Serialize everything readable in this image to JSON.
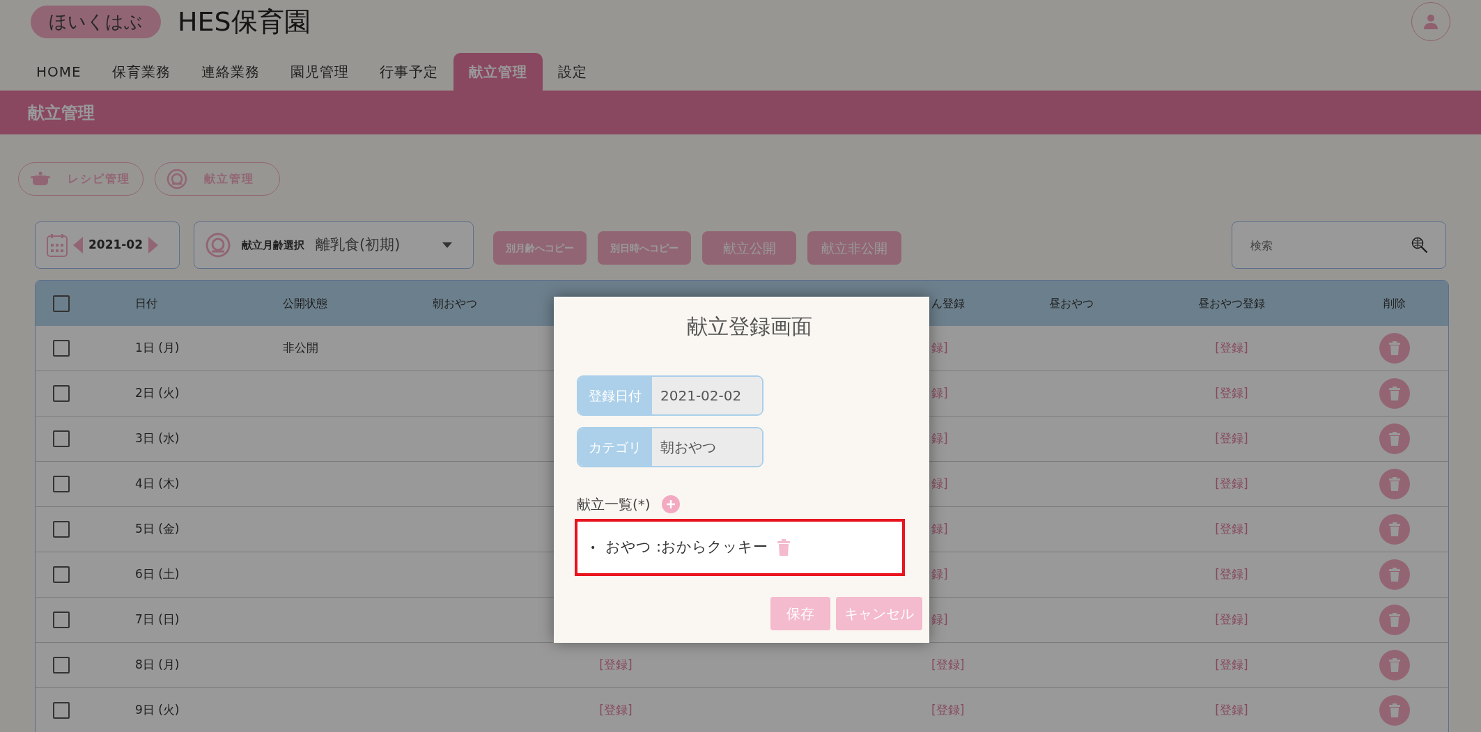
{
  "header": {
    "logo": "ほいくはぶ",
    "title": "HES保育園"
  },
  "tabs": [
    {
      "label": "HOME",
      "selected": false
    },
    {
      "label": "保育業務",
      "selected": false
    },
    {
      "label": "連絡業務",
      "selected": false
    },
    {
      "label": "園児管理",
      "selected": false
    },
    {
      "label": "行事予定",
      "selected": false
    },
    {
      "label": "献立管理",
      "selected": true
    },
    {
      "label": "設定",
      "selected": false
    }
  ],
  "page_title": "献立管理",
  "sub_nav": [
    {
      "label": "レシピ管理",
      "kind": "recipe"
    },
    {
      "label": "献立管理",
      "kind": "menu"
    }
  ],
  "toolbar": {
    "month": "2021-02",
    "age_label": "献立月齢選択",
    "age_value": "離乳食(初期)",
    "buttons": [
      "別月齢へコピー",
      "別日時へコピー",
      "献立公開",
      "献立非公開"
    ],
    "search": {
      "placeholder": "検索"
    }
  },
  "table": {
    "header_checked": false,
    "columns": {
      "date": "日付",
      "publish_status": "公開状態",
      "morning_snack": "朝おやつ",
      "column_5": "ん登録",
      "afternoon_snack": "昼おやつ",
      "afternoon_snack_register": "昼おやつ登録",
      "delete": "削除"
    },
    "rows": [
      {
        "checked": false,
        "date": "1日 (月)",
        "publish_status": "非公開",
        "column_5": "録]",
        "afternoon_snack_register": "[登録]"
      },
      {
        "checked": false,
        "date": "2日 (火)",
        "column_5": "録]",
        "afternoon_snack_register": "[登録]"
      },
      {
        "checked": false,
        "date": "3日 (水)",
        "column_5": "録]",
        "afternoon_snack_register": "[登録]"
      },
      {
        "checked": false,
        "date": "4日 (木)",
        "column_5": "録]",
        "afternoon_snack_register": "[登録]"
      },
      {
        "checked": false,
        "date": "5日 (金)",
        "column_5": "録]",
        "afternoon_snack_register": "[登録]"
      },
      {
        "checked": false,
        "date": "6日 (土)",
        "column_5": "録]",
        "afternoon_snack_register": "[登録]"
      },
      {
        "checked": false,
        "date": "7日 (日)",
        "column_5": "録]",
        "afternoon_snack_register": "[登録]"
      },
      {
        "checked": false,
        "date": "8日 (月)",
        "column_4": "[登録]",
        "column_5": "[登録]",
        "afternoon_snack_register": "[登録]"
      },
      {
        "checked": false,
        "date": "9日 (火)",
        "column_4": "[登録]",
        "column_5": "[登録]",
        "afternoon_snack_register": "[登録]"
      }
    ]
  },
  "modal": {
    "title": "献立登録画面",
    "fields": [
      {
        "label": "登録日付",
        "value": "2021-02-02"
      },
      {
        "label": "カテゴリ",
        "value": "朝おやつ"
      }
    ],
    "list_label": "献立一覧(*)",
    "items": [
      {
        "bullet": "•",
        "text": "おやつ :おからクッキー"
      }
    ],
    "buttons": [
      "保存",
      "キャンセル"
    ]
  }
}
